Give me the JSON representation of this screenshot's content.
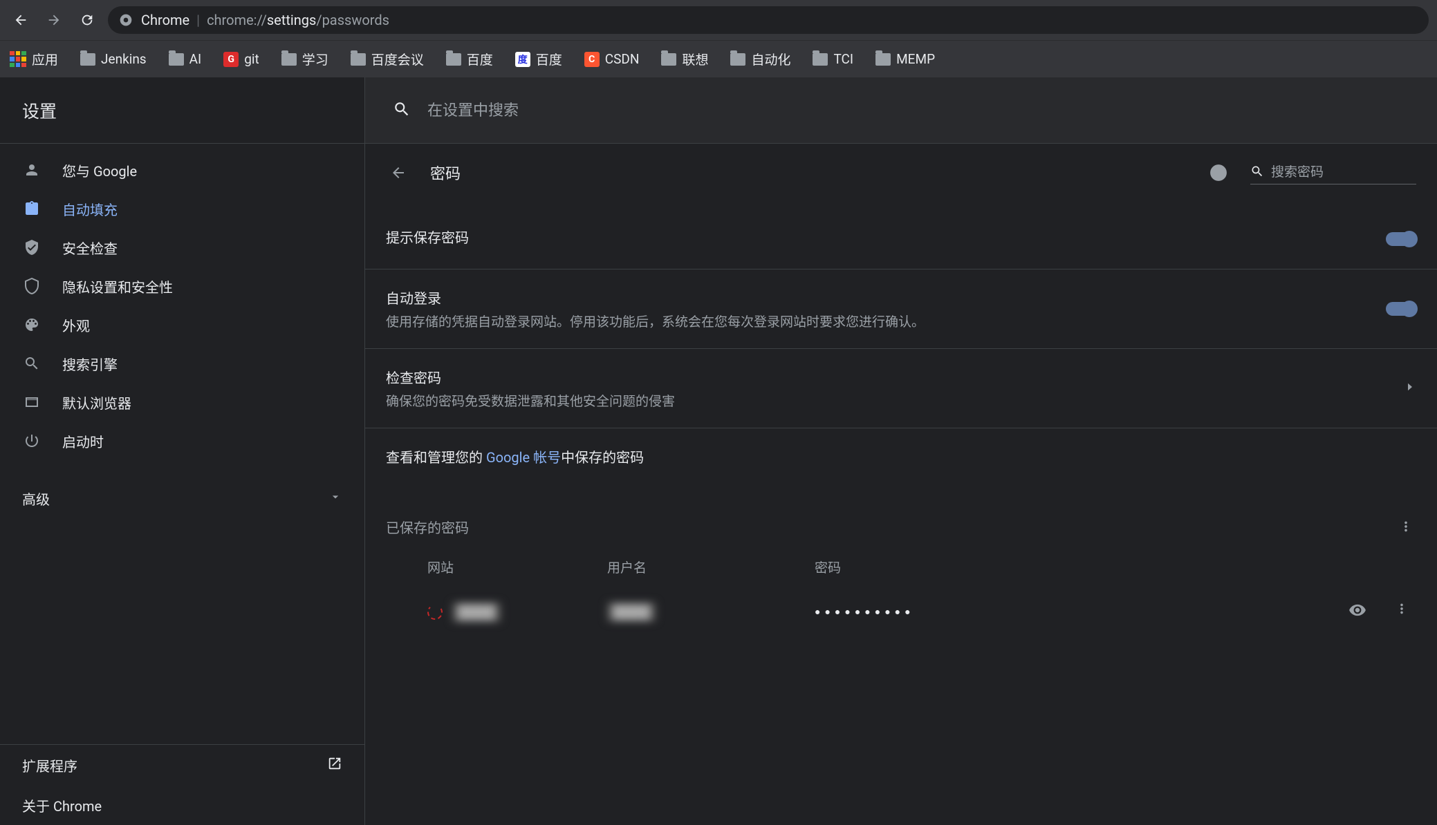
{
  "url": {
    "app": "Chrome",
    "scheme": "chrome://",
    "path_pre": "settings",
    "path_post": "/passwords"
  },
  "bookmarks": {
    "apps_label": "应用",
    "items": [
      {
        "label": "Jenkins",
        "type": "folder"
      },
      {
        "label": "AI",
        "type": "folder"
      },
      {
        "label": "git",
        "type": "favicon-g"
      },
      {
        "label": "学习",
        "type": "folder"
      },
      {
        "label": "百度会议",
        "type": "folder"
      },
      {
        "label": "百度",
        "type": "folder"
      },
      {
        "label": "百度",
        "type": "favicon-baidu"
      },
      {
        "label": "CSDN",
        "type": "favicon-csdn"
      },
      {
        "label": "联想",
        "type": "folder"
      },
      {
        "label": "自动化",
        "type": "folder"
      },
      {
        "label": "TCI",
        "type": "folder"
      },
      {
        "label": "MEMP",
        "type": "folder"
      }
    ]
  },
  "sidebar": {
    "title": "设置",
    "items": [
      {
        "label": "您与 Google",
        "icon": "person"
      },
      {
        "label": "自动填充",
        "icon": "clipboard",
        "selected": true
      },
      {
        "label": "安全检查",
        "icon": "shield-check"
      },
      {
        "label": "隐私设置和安全性",
        "icon": "shield"
      },
      {
        "label": "外观",
        "icon": "palette"
      },
      {
        "label": "搜索引擎",
        "icon": "search"
      },
      {
        "label": "默认浏览器",
        "icon": "browser"
      },
      {
        "label": "启动时",
        "icon": "power"
      }
    ],
    "advanced": "高级",
    "extensions": "扩展程序",
    "about": "关于 Chrome"
  },
  "main": {
    "search_placeholder": "在设置中搜索",
    "page_title": "密码",
    "search_passwords_placeholder": "搜索密码",
    "rows": [
      {
        "title": "提示保存密码",
        "desc": "",
        "control": "toggle"
      },
      {
        "title": "自动登录",
        "desc": "使用存储的凭据自动登录网站。停用该功能后，系统会在您每次登录网站时要求您进行确认。",
        "control": "toggle"
      },
      {
        "title": "检查密码",
        "desc": "确保您的密码免受数据泄露和其他安全问题的侵害",
        "control": "chevron"
      }
    ],
    "google_account_pre": "查看和管理您的 ",
    "google_account_link": "Google 帐号",
    "google_account_post": "中保存的密码",
    "saved_passwords_title": "已保存的密码",
    "table": {
      "site": "网站",
      "username": "用户名",
      "password": "密码"
    },
    "password_row": {
      "site": "████",
      "user": "████",
      "mask": "●●●●●●●●●●"
    }
  }
}
